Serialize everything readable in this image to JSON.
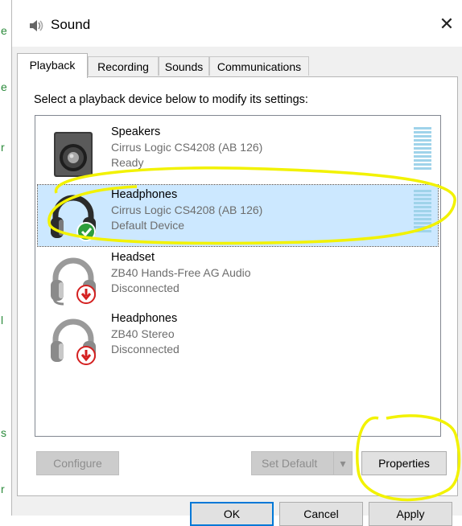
{
  "window": {
    "title": "Sound"
  },
  "background_chars": [
    "e",
    "e",
    "r",
    "l",
    "s",
    "r"
  ],
  "tabs": [
    {
      "label": "Playback",
      "active": true
    },
    {
      "label": "Recording",
      "active": false
    },
    {
      "label": "Sounds",
      "active": false
    },
    {
      "label": "Communications",
      "active": false
    }
  ],
  "instruction": "Select a playback device below to modify its settings:",
  "devices": [
    {
      "name": "Speakers",
      "driver": "Cirrus Logic CS4208 (AB 126)",
      "status": "Ready",
      "icon": "speaker-icon",
      "badge": "none",
      "selected": false
    },
    {
      "name": "Headphones",
      "driver": "Cirrus Logic CS4208 (AB 126)",
      "status": "Default Device",
      "icon": "headphones-icon",
      "badge": "default-check",
      "selected": true
    },
    {
      "name": "Headset",
      "driver": "ZB40 Hands-Free AG Audio",
      "status": "Disconnected",
      "icon": "headset-icon",
      "badge": "disconnected-arrow",
      "selected": false
    },
    {
      "name": "Headphones",
      "driver": "ZB40 Stereo",
      "status": "Disconnected",
      "icon": "headphones-icon",
      "badge": "disconnected-arrow",
      "selected": false
    }
  ],
  "buttons": {
    "configure": "Configure",
    "set_default": "Set Default",
    "properties": "Properties",
    "ok": "OK",
    "cancel": "Cancel",
    "apply": "Apply"
  },
  "colors": {
    "selection": "#cce8ff",
    "level_meter": "#9fd3ea",
    "annotation": "#f2f200",
    "default_badge": "#2e9e3c",
    "disconnected_badge": "#d42020",
    "focus_border": "#0078d7"
  }
}
